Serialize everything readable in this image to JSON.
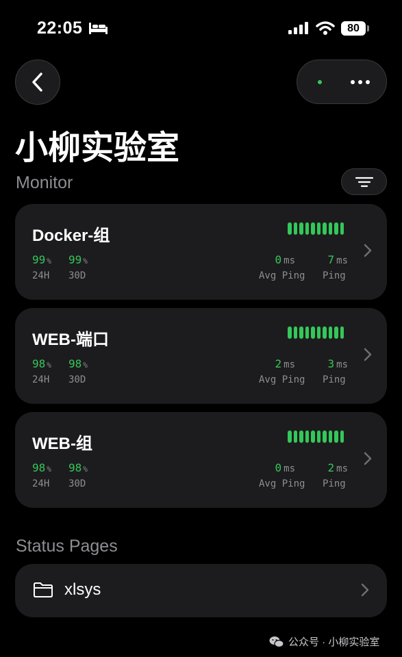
{
  "status_bar": {
    "time": "22:05",
    "battery": "80"
  },
  "header": {
    "title": "小柳实验室"
  },
  "monitor": {
    "section_label": "Monitor",
    "items": [
      {
        "name": "Docker-组",
        "uptime_24h": "99",
        "uptime_30d": "99",
        "avg_ping": "0",
        "ping": "7",
        "bars": 10
      },
      {
        "name": "WEB-端口",
        "uptime_24h": "98",
        "uptime_30d": "98",
        "avg_ping": "2",
        "ping": "3",
        "bars": 10
      },
      {
        "name": "WEB-组",
        "uptime_24h": "98",
        "uptime_30d": "98",
        "avg_ping": "0",
        "ping": "2",
        "bars": 10
      }
    ],
    "labels": {
      "percent": "%",
      "h24": "24H",
      "d30": "30D",
      "ms": "ms",
      "avg_ping": "Avg Ping",
      "ping": "Ping"
    }
  },
  "status_pages": {
    "section_label": "Status Pages",
    "items": [
      {
        "name": "xlsys"
      }
    ]
  },
  "watermark": {
    "text": "公众号 · 小柳实验室"
  },
  "colors": {
    "accent": "#34c759",
    "card": "#1c1c1e",
    "muted": "#8e8e93"
  }
}
